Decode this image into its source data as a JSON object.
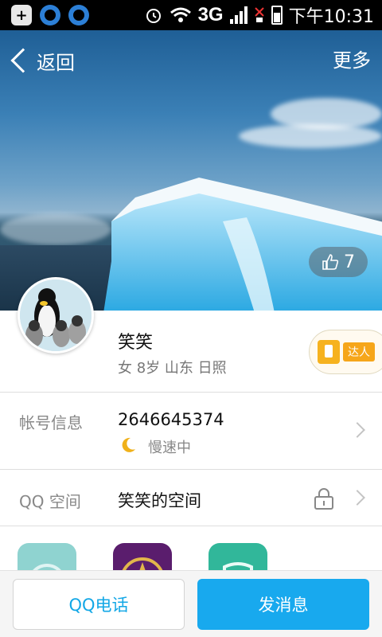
{
  "status_bar": {
    "network": "3G",
    "time": "下午10:31"
  },
  "header": {
    "back_label": "返回",
    "more_label": "更多",
    "like_count": "7"
  },
  "profile": {
    "name": "笑笑",
    "meta": "女 8岁 山东 日照",
    "badge_label": "达人"
  },
  "account": {
    "label": "帐号信息",
    "number": "2646645374",
    "status": "慢速中"
  },
  "qzone": {
    "label": "QQ 空间",
    "value": "笑笑的空间"
  },
  "apps": [
    {
      "icon": "music-app-icon",
      "color": "#8fd3d0"
    },
    {
      "icon": "star-app-icon",
      "color": "#5a1d6d"
    },
    {
      "icon": "flag-app-icon",
      "color": "#31b79a"
    }
  ],
  "bottom": {
    "call_label": "QQ电话",
    "message_label": "发消息"
  }
}
